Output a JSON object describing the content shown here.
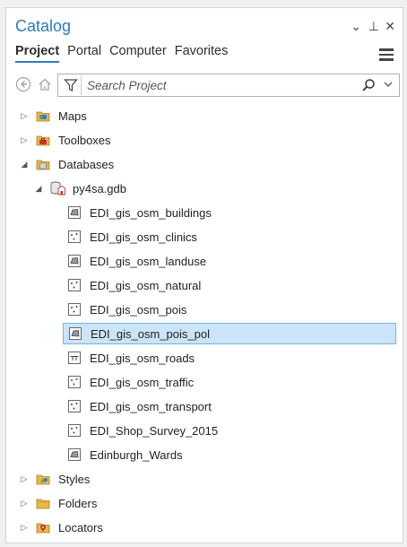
{
  "window": {
    "title": "Catalog",
    "dropdown_glyph": "⌄",
    "pin_glyph": "⊥",
    "close_glyph": "✕"
  },
  "tabs": [
    {
      "label": "Project",
      "active": true
    },
    {
      "label": "Portal",
      "active": false
    },
    {
      "label": "Computer",
      "active": false
    },
    {
      "label": "Favorites",
      "active": false
    }
  ],
  "search": {
    "placeholder": "Search Project",
    "value": ""
  },
  "tree": [
    {
      "label": "Maps",
      "icon": "maps-folder-icon",
      "expander": "▷"
    },
    {
      "label": "Toolboxes",
      "icon": "toolbox-icon",
      "expander": "▷"
    },
    {
      "label": "Databases",
      "icon": "database-folder-icon",
      "expander": "◢"
    },
    {
      "label": "py4sa.gdb",
      "icon": "geodatabase-icon",
      "expander": "◢"
    },
    {
      "label": "EDI_gis_osm_buildings",
      "icon": "polygon-featureclass-icon"
    },
    {
      "label": "EDI_gis_osm_clinics",
      "icon": "point-featureclass-icon"
    },
    {
      "label": "EDI_gis_osm_landuse",
      "icon": "polygon-featureclass-icon"
    },
    {
      "label": "EDI_gis_osm_natural",
      "icon": "point-featureclass-icon"
    },
    {
      "label": "EDI_gis_osm_pois",
      "icon": "point-featureclass-icon"
    },
    {
      "label": "EDI_gis_osm_pois_pol",
      "icon": "polygon-featureclass-icon",
      "selected": true
    },
    {
      "label": "EDI_gis_osm_roads",
      "icon": "line-featureclass-icon"
    },
    {
      "label": "EDI_gis_osm_traffic",
      "icon": "point-featureclass-icon"
    },
    {
      "label": "EDI_gis_osm_transport",
      "icon": "point-featureclass-icon"
    },
    {
      "label": "EDI_Shop_Survey_2015",
      "icon": "point-featureclass-icon"
    },
    {
      "label": "Edinburgh_Wards",
      "icon": "polygon-featureclass-icon"
    },
    {
      "label": "Styles",
      "icon": "styles-icon",
      "expander": "▷"
    },
    {
      "label": "Folders",
      "icon": "folders-icon",
      "expander": "▷"
    },
    {
      "label": "Locators",
      "icon": "locators-icon",
      "expander": "▷"
    }
  ],
  "colors": {
    "accent": "#2e7bb8",
    "selection": "#cce4f7",
    "selection_border": "#7ab3de"
  }
}
